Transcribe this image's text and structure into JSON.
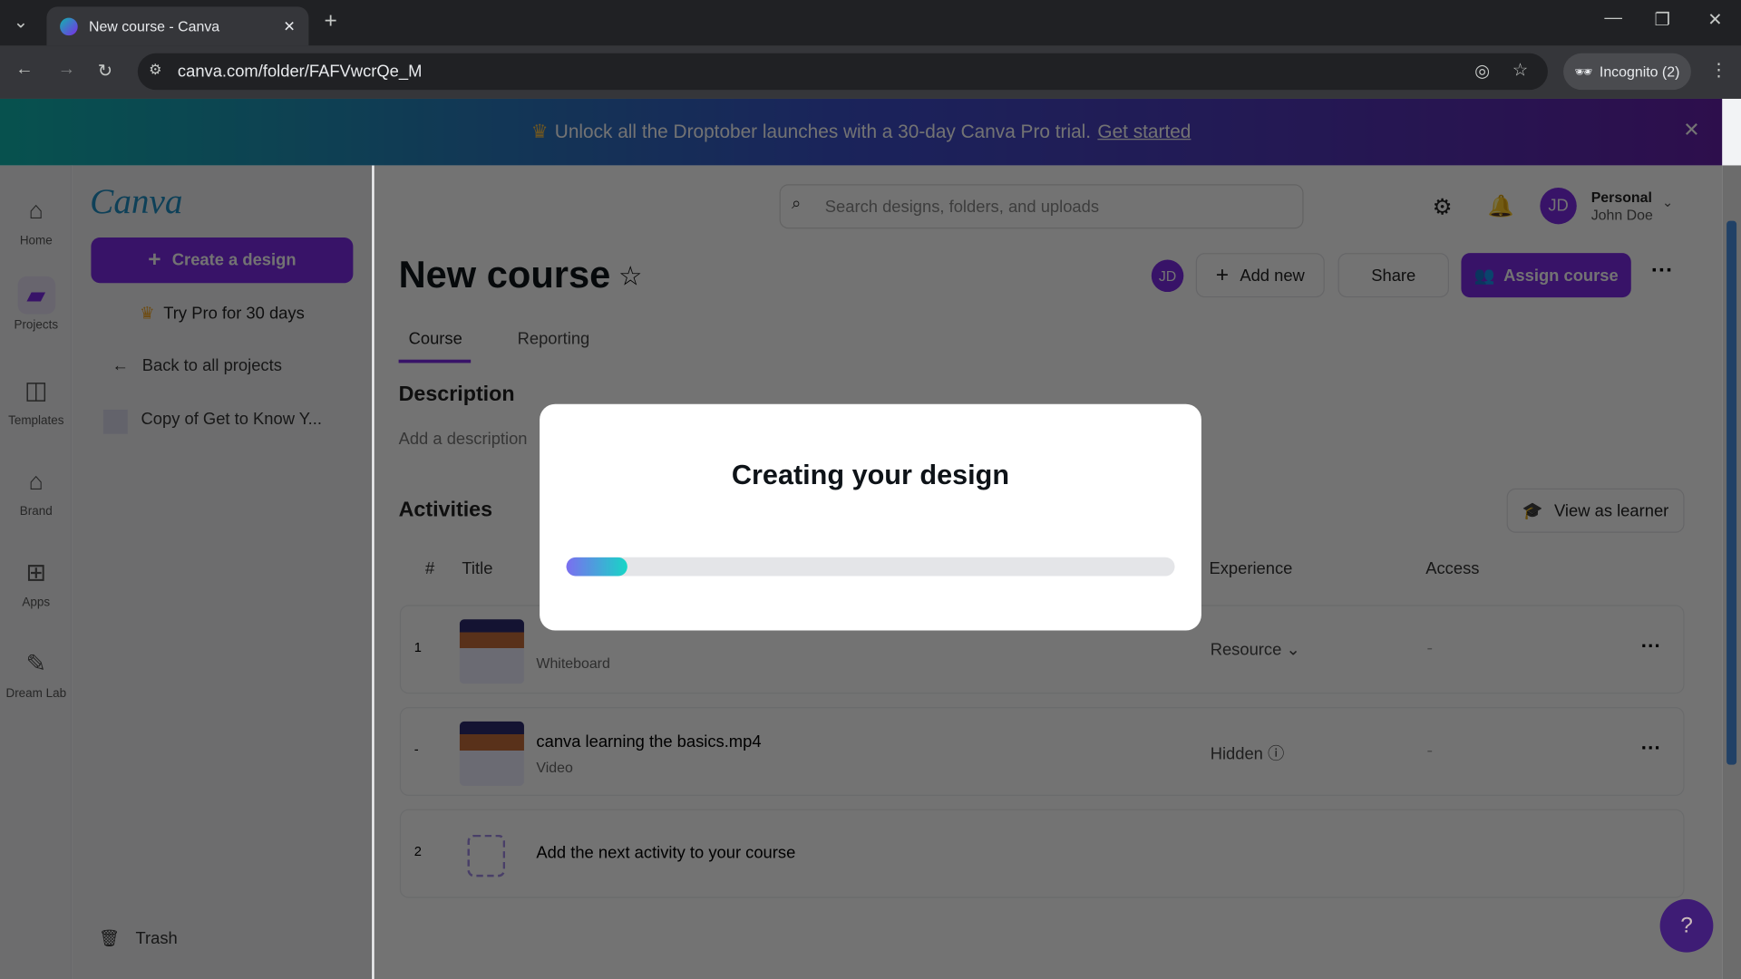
{
  "browser": {
    "tab_title": "New course - Canva",
    "url": "canva.com/folder/FAFVwcrQe_M",
    "incognito_label": "Incognito (2)"
  },
  "banner": {
    "text": "Unlock all the Droptober launches with a 30-day Canva Pro trial.",
    "link": "Get started"
  },
  "rail": [
    {
      "label": "Home",
      "icon": "home-icon"
    },
    {
      "label": "Projects",
      "icon": "folder-icon"
    },
    {
      "label": "Templates",
      "icon": "templates-icon"
    },
    {
      "label": "Brand",
      "icon": "brand-icon"
    },
    {
      "label": "Apps",
      "icon": "apps-icon"
    },
    {
      "label": "Dream Lab",
      "icon": "dream-lab-icon"
    }
  ],
  "sidebar": {
    "logo": "Canva",
    "create": "Create a design",
    "try_pro": "Try Pro for 30 days",
    "back": "Back to all projects",
    "recent": "Copy of Get to Know Y...",
    "trash": "Trash"
  },
  "header": {
    "search_placeholder": "Search designs, folders, and uploads",
    "account_type": "Personal",
    "user_name": "John Doe",
    "initials": "JD"
  },
  "course": {
    "title": "New course",
    "add_new": "Add new",
    "share": "Share",
    "assign": "Assign course",
    "tabs": [
      "Course",
      "Reporting"
    ],
    "description_heading": "Description",
    "description_placeholder": "Add a description",
    "activities_heading": "Activities",
    "view_as_learner": "View as learner",
    "columns": [
      "#",
      "Title",
      "Experience",
      "Access"
    ],
    "rows": [
      {
        "num": "1",
        "title": "",
        "type": "Whiteboard",
        "experience": "Resource",
        "access": "-"
      },
      {
        "num": "-",
        "title": "canva learning the basics.mp4",
        "type": "Video",
        "experience": "Hidden",
        "access": "-"
      }
    ],
    "add_next": {
      "num": "2",
      "label": "Add the next activity to your course"
    }
  },
  "modal": {
    "title": "Creating your design",
    "progress_percent": 10
  },
  "help": "?",
  "colors": {
    "brand_purple": "#7d2ae8",
    "progress_start": "#7b6ef0",
    "progress_end": "#17d6c6"
  }
}
